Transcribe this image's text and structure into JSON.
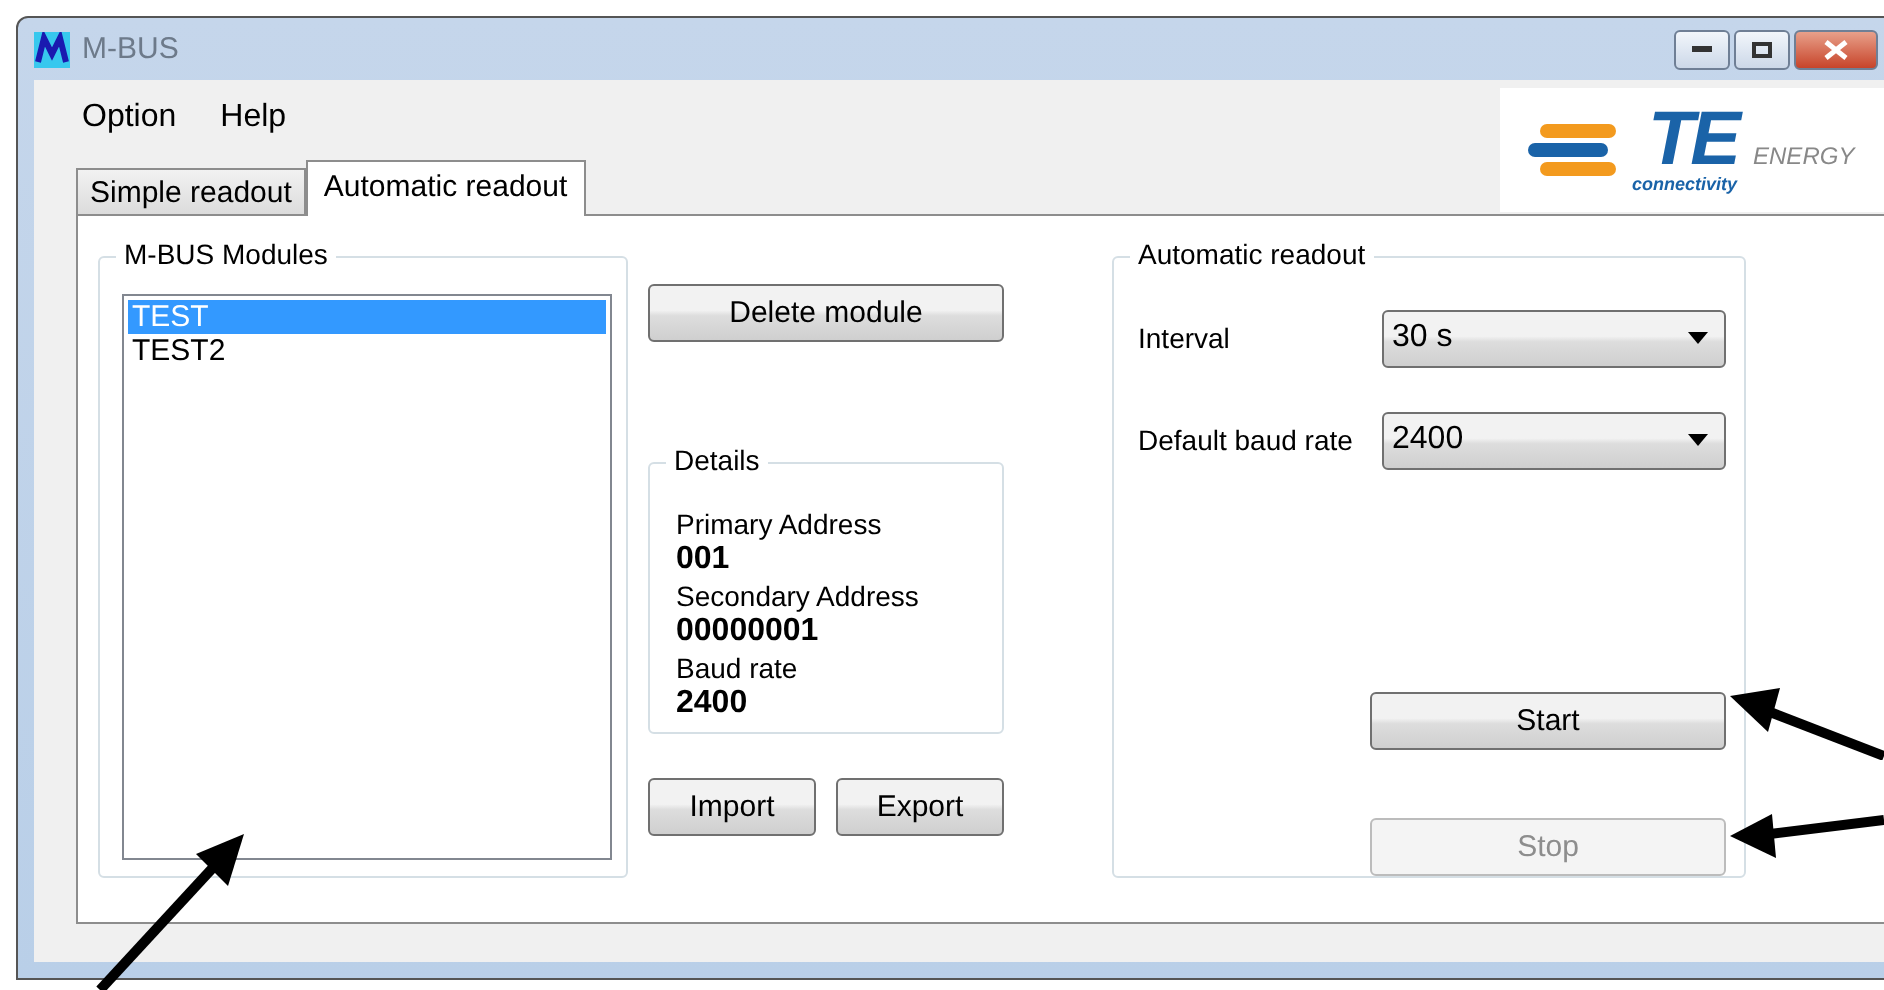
{
  "window": {
    "title": "M-BUS"
  },
  "menu": [
    {
      "label": "Option"
    },
    {
      "label": "Help"
    }
  ],
  "tabs": [
    {
      "label": "Simple readout",
      "selected": false
    },
    {
      "label": "Automatic readout",
      "selected": true
    }
  ],
  "logo": {
    "wordmark": "TE",
    "subtitle": "connectivity",
    "tagline": "ENERGY"
  },
  "modules": {
    "title": "M-BUS Modules",
    "items": [
      {
        "label": "TEST",
        "selected": true
      },
      {
        "label": "TEST2",
        "selected": false
      }
    ]
  },
  "delete_button": {
    "label": "Delete module"
  },
  "details": {
    "title": "Details",
    "fields": [
      {
        "label": "Primary Address",
        "value": "001"
      },
      {
        "label": "Secondary Address",
        "value": "00000001"
      },
      {
        "label": "Baud rate",
        "value": "2400"
      }
    ]
  },
  "io_buttons": [
    {
      "label": "Import"
    },
    {
      "label": "Export"
    }
  ],
  "automatic": {
    "title": "Automatic readout",
    "settings": [
      {
        "label": "Interval",
        "value": "30 s"
      },
      {
        "label": "Default baud rate",
        "value": "2400"
      }
    ],
    "buttons": [
      {
        "label": "Start",
        "disabled": false
      },
      {
        "label": "Stop",
        "disabled": true
      }
    ]
  }
}
